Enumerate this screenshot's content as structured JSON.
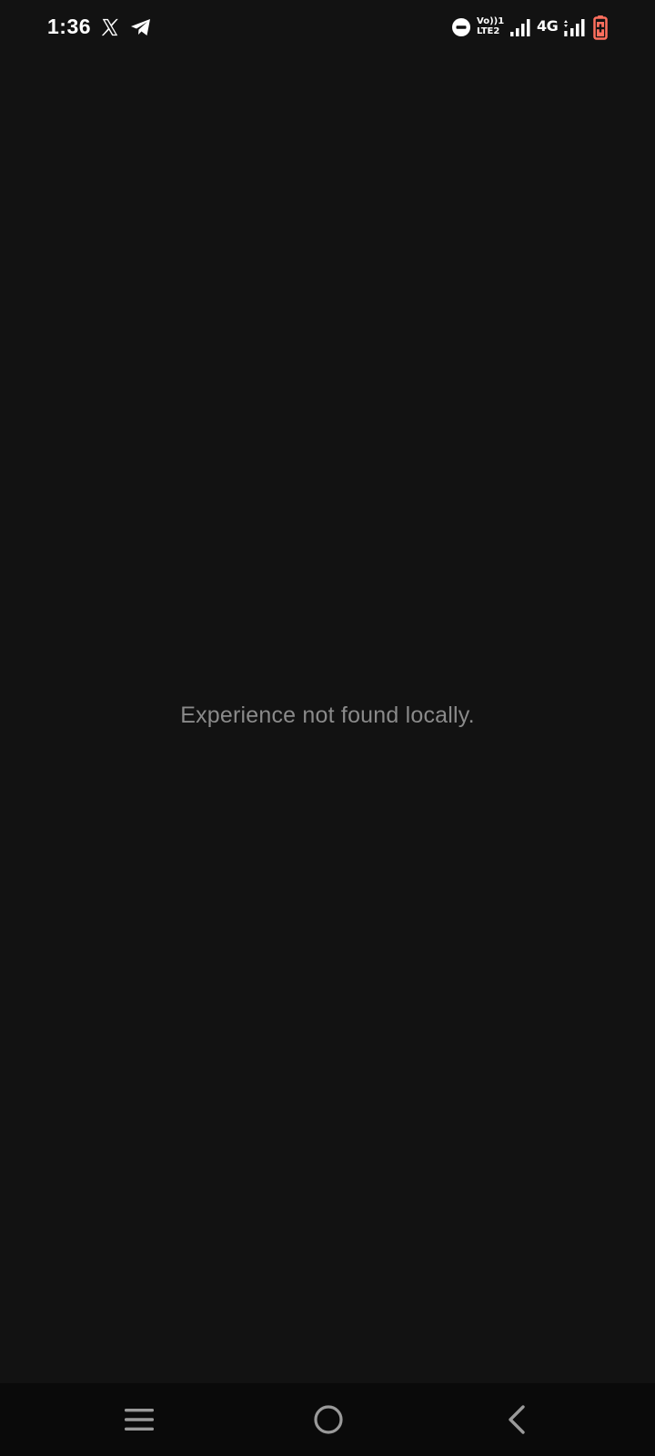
{
  "status_bar": {
    "time": "1:36",
    "left_icons": [
      "x-icon",
      "telegram-icon"
    ],
    "volte_top": "Vo))1",
    "volte_bottom": "LTE2",
    "network_type": "4G",
    "right_icons": [
      "dnd-icon",
      "signal-icon",
      "signal-icon",
      "battery-icon"
    ],
    "battery_color": "#ff6f5e"
  },
  "main": {
    "message": "Experience not found locally."
  },
  "navigation_bar": {
    "buttons": [
      "menu-icon",
      "home-icon",
      "back-icon"
    ]
  },
  "colors": {
    "background": "#121212",
    "nav_background": "#0a0a0a",
    "message_text": "#8a8a8a",
    "nav_icon": "#9a9a9a"
  }
}
